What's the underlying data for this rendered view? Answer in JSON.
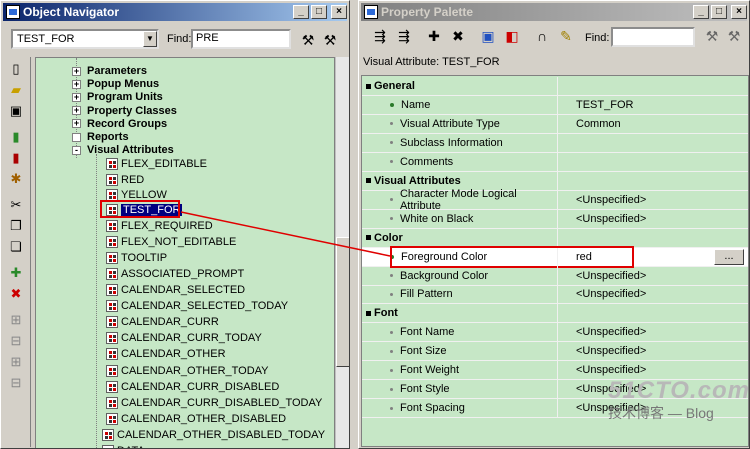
{
  "navigator": {
    "title": "Object Navigator",
    "module_combo_value": "TEST_FOR",
    "find_label": "Find:",
    "find_value": "PRE",
    "tree_groups": [
      {
        "label": "Parameters",
        "state": "+"
      },
      {
        "label": "Popup Menus",
        "state": "+"
      },
      {
        "label": "Program Units",
        "state": "+"
      },
      {
        "label": "Property Classes",
        "state": "+"
      },
      {
        "label": "Record Groups",
        "state": "+"
      },
      {
        "label": "Reports",
        "state": ""
      },
      {
        "label": "Visual Attributes",
        "state": "-"
      }
    ],
    "visual_attributes": [
      "FLEX_EDITABLE",
      "RED",
      "YELLOW",
      "TEST_FOR",
      "FLEX_REQUIRED",
      "FLEX_NOT_EDITABLE",
      "TOOLTIP",
      "ASSOCIATED_PROMPT",
      "CALENDAR_SELECTED",
      "CALENDAR_SELECTED_TODAY",
      "CALENDAR_CURR",
      "CALENDAR_CURR_TODAY",
      "CALENDAR_OTHER",
      "CALENDAR_OTHER_TODAY",
      "CALENDAR_CURR_DISABLED",
      "CALENDAR_CURR_DISABLED_TODAY",
      "CALENDAR_OTHER_DISABLED",
      "CALENDAR_OTHER_DISABLED_TODAY",
      "DATA"
    ],
    "selected_item": "TEST_FOR"
  },
  "palette": {
    "title": "Property Palette",
    "find_label": "Find:",
    "find_value": "",
    "caption": "Visual Attribute: TEST_FOR",
    "rows": [
      {
        "type": "header",
        "label": "General"
      },
      {
        "type": "prop",
        "label": "Name",
        "value": "TEST_FOR",
        "marked": true
      },
      {
        "type": "prop",
        "label": "Visual Attribute Type",
        "value": "Common"
      },
      {
        "type": "prop",
        "label": "Subclass Information",
        "value": ""
      },
      {
        "type": "prop",
        "label": "Comments",
        "value": ""
      },
      {
        "type": "header",
        "label": "Visual Attributes"
      },
      {
        "type": "prop",
        "label": "Character Mode Logical Attribute",
        "value": "<Unspecified>"
      },
      {
        "type": "prop",
        "label": "White on Black",
        "value": "<Unspecified>"
      },
      {
        "type": "header",
        "label": "Color"
      },
      {
        "type": "prop",
        "label": "Foreground Color",
        "value": "red",
        "selected": true,
        "marked": true
      },
      {
        "type": "prop",
        "label": "Background Color",
        "value": "<Unspecified>"
      },
      {
        "type": "prop",
        "label": "Fill Pattern",
        "value": "<Unspecified>"
      },
      {
        "type": "header",
        "label": "Font"
      },
      {
        "type": "prop",
        "label": "Font Name",
        "value": "<Unspecified>"
      },
      {
        "type": "prop",
        "label": "Font Size",
        "value": "<Unspecified>"
      },
      {
        "type": "prop",
        "label": "Font Weight",
        "value": "<Unspecified>"
      },
      {
        "type": "prop",
        "label": "Font Style",
        "value": "<Unspecified>"
      },
      {
        "type": "prop",
        "label": "Font Spacing",
        "value": "<Unspecified>"
      }
    ],
    "ellipsis_label": "..."
  },
  "watermark": {
    "line1": "51CTO.com",
    "line2": "技术博客 — Blog"
  },
  "colors": {
    "accent_red": "#e00000",
    "tree_bg": "#c6e7c6",
    "title_active": "#0a246a"
  }
}
